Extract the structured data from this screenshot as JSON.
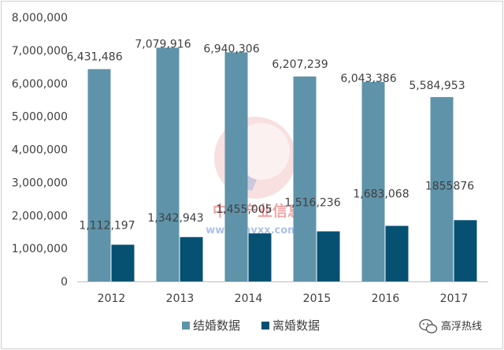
{
  "chart_data": {
    "type": "bar",
    "categories": [
      "2012",
      "2013",
      "2014",
      "2015",
      "2016",
      "2017"
    ],
    "series": [
      {
        "name": "结婚数据",
        "color": "#5f93a9",
        "values": [
          6431486,
          7079916,
          6940306,
          6207239,
          6043386,
          5584953
        ],
        "labels": [
          "6,431,486",
          "7,079,916",
          "6,940,306",
          "6,207,239",
          "6,043,386",
          "5,584,953"
        ]
      },
      {
        "name": "离婚数据",
        "color": "#065072",
        "values": [
          1112197,
          1342943,
          1455005,
          1516236,
          1683068,
          1855876
        ],
        "labels": [
          "1,112,197",
          "1,342,943",
          "1,455,005",
          "1,516,236",
          "1,683,068",
          "1855876"
        ]
      }
    ],
    "y_ticks": [
      "0",
      "1,000,000",
      "2,000,000",
      "3,000,000",
      "4,000,000",
      "5,000,000",
      "6,000,000",
      "7,000,000",
      "8,000,000"
    ],
    "ylim": [
      0,
      8000000
    ],
    "grid": false,
    "legend_position": "bottom"
  },
  "watermark": {
    "text": "中国产业信息",
    "url": "www.chyxx.com"
  },
  "corner_label": {
    "text": "高浮热线",
    "icon": "wechat-icon"
  }
}
